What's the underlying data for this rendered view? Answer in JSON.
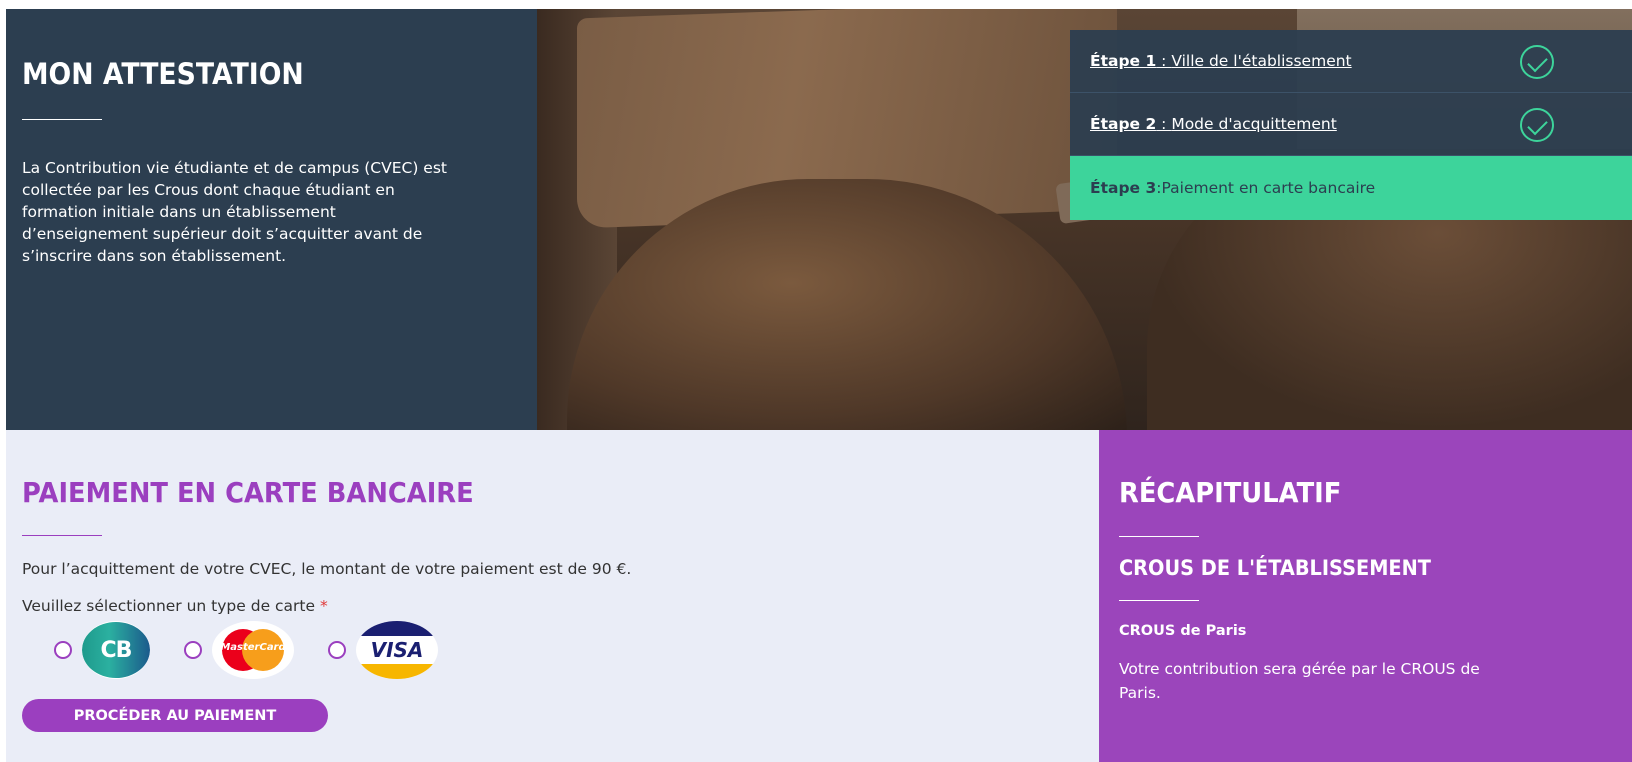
{
  "intro": {
    "title": "MON ATTESTATION",
    "text": "La Contribution vie étudiante et de campus (CVEC) est collectée par les Crous dont chaque étudiant en formation initiale dans un établissement d’enseignement supérieur doit s’acquitter avant de s’inscrire dans son établissement."
  },
  "steps": [
    {
      "num": "Étape 1",
      "sep": " : ",
      "label": "Ville de l'établissement",
      "status": "done"
    },
    {
      "num": "Étape 2",
      "sep": " : ",
      "label": "Mode d'acquittement",
      "status": "done"
    },
    {
      "num": "Étape 3",
      "sep": " : ",
      "label": "Paiement en carte bancaire",
      "status": "active"
    }
  ],
  "payment": {
    "title": "PAIEMENT EN CARTE BANCAIRE",
    "amount_text": "Pour l’acquittement de votre CVEC, le montant de votre paiement est de 90 €.",
    "select_label": "Veuillez sélectionner un type de carte",
    "required_mark": "*",
    "cards": [
      {
        "name": "CB",
        "icon": "cb-logo-icon"
      },
      {
        "name": "MasterCard",
        "icon": "mastercard-logo-icon"
      },
      {
        "name": "VISA",
        "icon": "visa-logo-icon"
      }
    ],
    "button_label": "PROCÉDER AU PAIEMENT"
  },
  "recap": {
    "title": "RÉCAPITULATIF",
    "subtitle": "CROUS DE L'ÉTABLISSEMENT",
    "crous_name": "CROUS de Paris",
    "crous_desc_line1": "Votre contribution sera gérée par le CROUS de",
    "crous_desc_line2": "Paris."
  },
  "colors": {
    "dark": "#2c3e50",
    "green": "#3dd49b",
    "purple": "#9b3fbf",
    "light_bg": "#eaedf7"
  }
}
